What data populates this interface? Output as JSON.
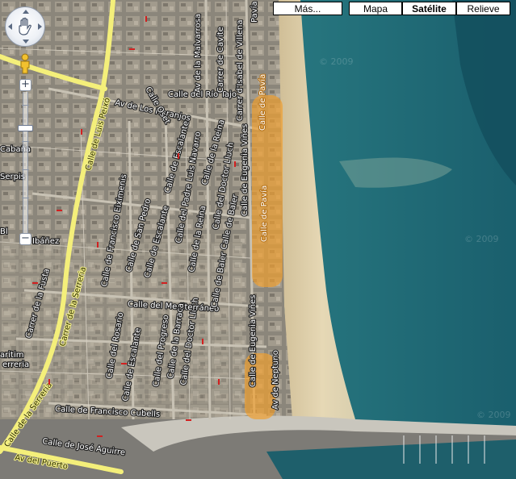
{
  "map_type_controls": {
    "more_label": "Más...",
    "map_label": "Mapa",
    "satellite_label": "Satélite",
    "terrain_label": "Relieve",
    "active": "Satélite"
  },
  "navigation": {
    "zoom_in_label": "+",
    "zoom_out_label": "−"
  },
  "colors": {
    "highlight": "#f0a030",
    "sea_deep": "#1f6f78",
    "sea_shallow": "#4a9c9a",
    "beach": "#e2d2ad",
    "city": "#8f8a7f",
    "major_road": "#f4ef7a"
  },
  "streets": {
    "pavia_1": "Calle de Pavía",
    "pavia_2": "Calle de Pavía",
    "pavia_3": "Calle de Pavía",
    "pavia_top": "Pavía",
    "isabel_villena": "Carrer d'Isabel de Villena",
    "eugenia_vines_1": "Calle de Eugenia Viñes",
    "eugenia_vines_2": "Calle de Eugenia Viñes",
    "eugenia_vines_3": "Calle de Eugenia Viñes",
    "neptuno": "Av de Neptuno",
    "rio_tajo": "Calle del Río Tajo",
    "cavite": "Carrer de Cavite",
    "malvarrosa": "Av de la Malvarrosa",
    "av_naranjos": "Av de Los Naranjos",
    "oset": "Calle Oset",
    "luis_peixo": "Calle de Luis Peixó",
    "serreria": "Carrer de la Serreria",
    "serreria_2": "Calle de la Serrería",
    "fusta": "Carrer de la Fusta",
    "escalante_1": "Calle de Escalante",
    "escalante_2": "Calle de Escalante",
    "escalante_3": "Calle de Escalante",
    "reina_1": "Calle de la Reina",
    "reina_2": "Calle de la Reina",
    "padre_luis_navarro": "Calle del Padre Luis Navarro",
    "doctor_lluch_1": "Calle del Doctor Lluch",
    "doctor_lluch_2": "Calle del Doctor Lluch",
    "francisco_eiximenis": "Calle de Francisco Eiximenis",
    "san_pedro": "Calle de San Pedro",
    "mediterraneo": "Calle del Mediterráneo",
    "rosario": "Calle del Rosario",
    "progreso": "Calle del Progreso",
    "barraca": "Calle de la Barraca",
    "baler_1": "Calle de Baler",
    "baler_2": "Calle de Baler",
    "francisco_cubells": "Calle de Francisco Cubells",
    "jose_aguirre": "Calle de José Aguirre",
    "av_puerto": "Av del Puerto",
    "edge_cabana": "Cabaña",
    "edge_serpis": "Serpis",
    "edge_ibanez": "Ibáñez",
    "edge_bi": "Bl",
    "edge_maritim": "aritim",
    "edge_serreria": "erreria"
  },
  "watermarks": {
    "top": "© 2009",
    "mid": "© 2009",
    "bottom": "© 2009"
  }
}
